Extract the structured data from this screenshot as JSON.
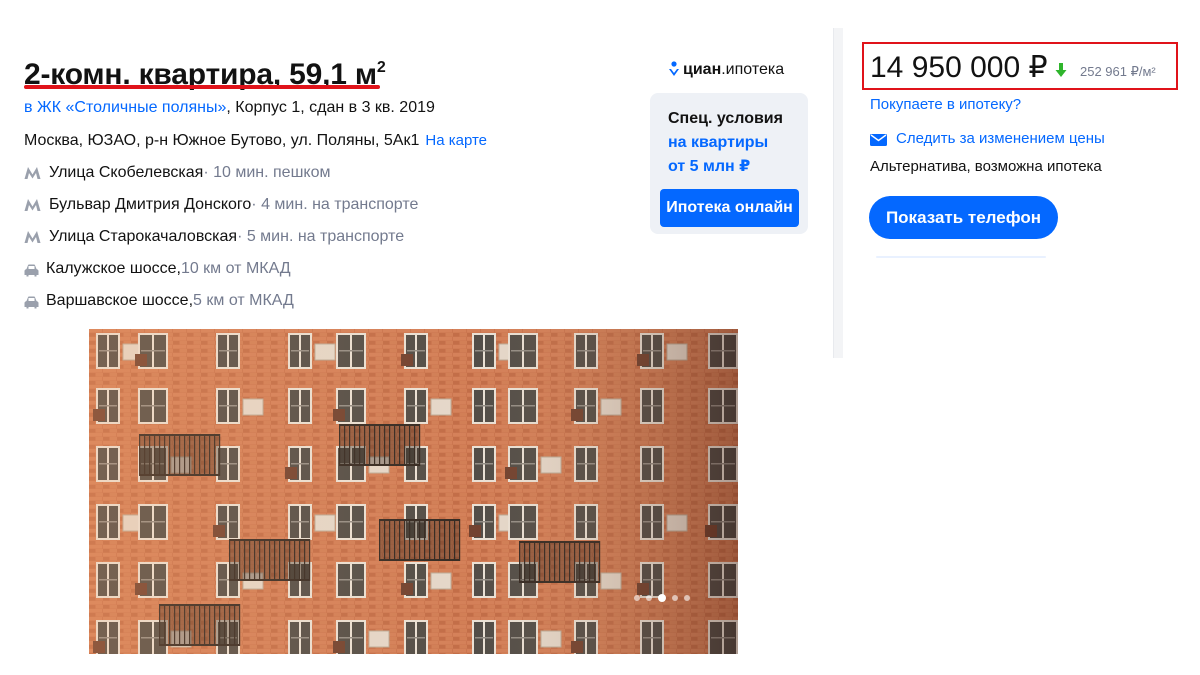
{
  "listing": {
    "title": "2-комн. квартира, 59,1 м",
    "title_sup": "2",
    "complex_link": "в ЖК «Столичные поляны»",
    "complex_info": ", Корпус 1, сдан в 3 кв. 2019",
    "address": "Москва, ЮЗАО, р-н Южное Бутово, ул. Поляны, 5Ак1",
    "map_link": "На карте"
  },
  "metro": [
    {
      "station": "Улица Скобелевская",
      "distance": " · 10 мин. пешком",
      "icon": "metro-icon"
    },
    {
      "station": "Бульвар Дмитрия Донского",
      "distance": " · 4 мин. на транспорте",
      "icon": "metro-icon"
    },
    {
      "station": "Улица Старокачаловская",
      "distance": " · 5 мин. на транспорте",
      "icon": "metro-icon"
    }
  ],
  "highways": [
    {
      "name": "Калужское шоссе, ",
      "distance": "10 км от МКАД",
      "icon": "car-icon"
    },
    {
      "name": "Варшавское шоссе, ",
      "distance": "5 км от МКАД",
      "icon": "car-icon"
    }
  ],
  "cian_mortgage": {
    "brand": "циан",
    "suffix": ".ипотека",
    "line1": "Спец. условия",
    "line2": "на квартиры",
    "line3": "от 5 млн ₽",
    "button": "Ипотека онлайн"
  },
  "price": {
    "value": "14 950 000 ₽",
    "per_meter": "252 961 ₽/м²",
    "trend": "down",
    "trend_color": "#2fb52c"
  },
  "sidebar": {
    "mortgage_question": "Покупаете в ипотеку?",
    "follow_price": "Следить за изменением цены",
    "deal_info": "Альтернатива, возможна ипотека",
    "show_phone": "Показать телефон"
  },
  "gallery": {
    "slide_count": 5,
    "active_slide": 3
  },
  "colors": {
    "accent": "#0468ff",
    "highlight": "#e0131a",
    "metro": "#9aa0ac"
  }
}
